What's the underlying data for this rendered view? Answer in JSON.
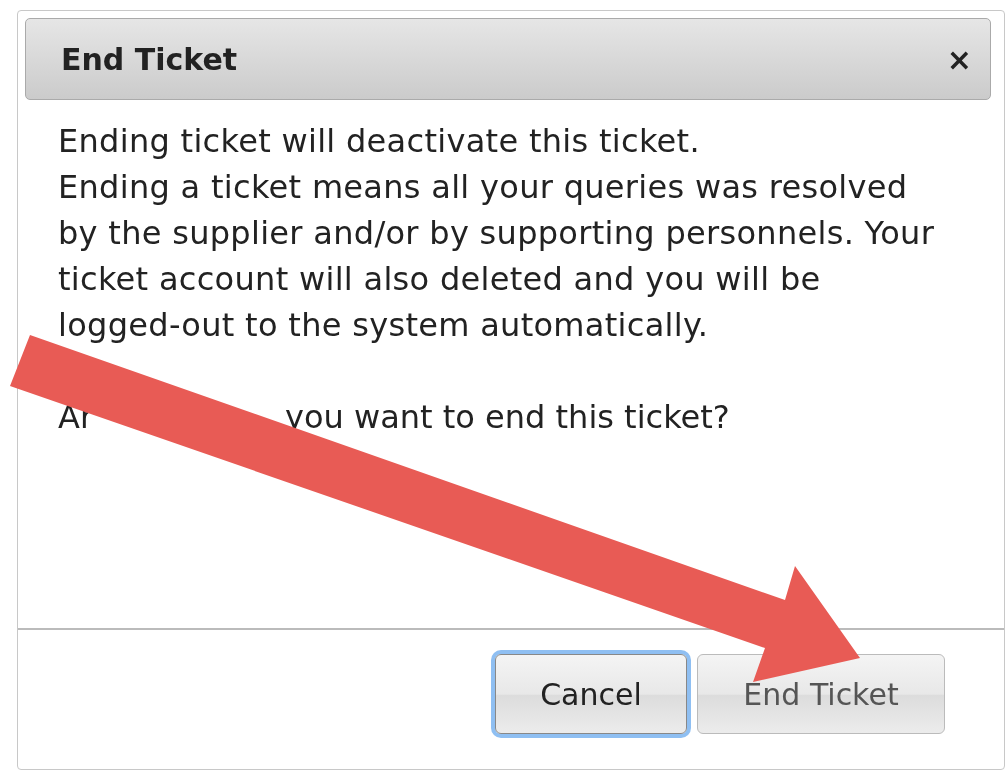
{
  "dialog": {
    "title": "End Ticket",
    "close": "×",
    "paragraphs": [
      "Ending ticket will deactivate this ticket.",
      "Ending a ticket means all your queries was resolved by the supplier and/or by supporting personnels. Your ticket account will also deleted and you will be logged-out to the system automatically."
    ],
    "question_fragments": [
      "Ar",
      "you want to end this ticket?"
    ],
    "buttons": [
      {
        "label": "Cancel",
        "focused": true
      },
      {
        "label": "End Ticket",
        "focused": false
      }
    ]
  },
  "annotation": {
    "kind": "arrow"
  }
}
